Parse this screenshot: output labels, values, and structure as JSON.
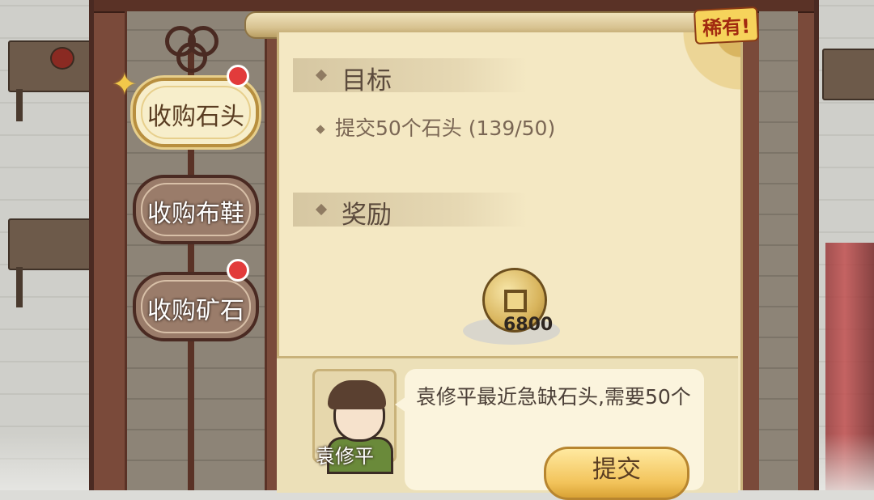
{
  "badge": {
    "rare": "稀有!"
  },
  "tabs": [
    {
      "label": "收购石头",
      "active": true,
      "has_dot": true
    },
    {
      "label": "收购布鞋",
      "active": false,
      "has_dot": false
    },
    {
      "label": "收购矿石",
      "active": false,
      "has_dot": true
    }
  ],
  "objective": {
    "title": "目标",
    "task": "提交50个石头 (139/50)"
  },
  "reward": {
    "title": "奖励",
    "amount": "6800",
    "icon": "copper-coin-icon"
  },
  "npc": {
    "name": "袁修平",
    "message": "袁修平最近急缺石头,需要50个"
  },
  "actions": {
    "submit_label": "提交"
  },
  "colors": {
    "panel": "#f4e8c3",
    "frame": "#7a4a3a",
    "accent_gold": "#f2c35a",
    "notification_red": "#e23b3b"
  }
}
